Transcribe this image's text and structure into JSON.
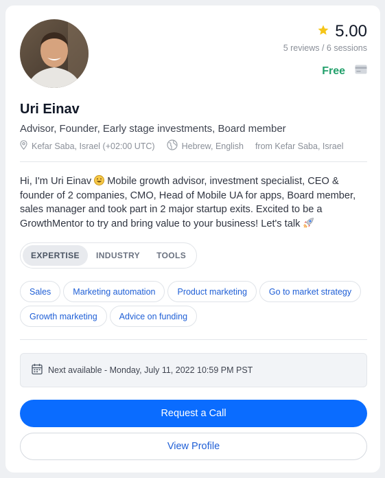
{
  "mentor": {
    "name": "Uri Einav",
    "title": "Advisor, Founder, Early stage investments, Board member",
    "location": "Kefar Saba, Israel (+02:00 UTC)",
    "languages": "Hebrew, English",
    "origin": "from Kefar Saba, Israel",
    "bio_parts": {
      "p1": "Hi, I'm Uri Einav ",
      "p2": " Mobile growth advisor, investment specialist, CEO & founder of 2 companies, CMO, Head of Mobile UA for apps, Board member, sales manager and took part in 2 major startup exits. Excited to be a GrowthMentor to try and bring value to your business! Let's talk "
    }
  },
  "rating": {
    "value": "5.00",
    "reviews_text": "5 reviews / 6 sessions",
    "star_color": "#f5c518"
  },
  "price": {
    "label": "Free",
    "color": "#22a06b"
  },
  "tabs": [
    "EXPERTISE",
    "INDUSTRY",
    "TOOLS"
  ],
  "active_tab": "EXPERTISE",
  "chips": [
    "Sales",
    "Marketing automation",
    "Product marketing",
    "Go to market strategy",
    "Growth marketing",
    "Advice on funding"
  ],
  "availability": "Next available - Monday, July 11, 2022 10:59 PM PST",
  "buttons": {
    "primary": "Request a Call",
    "secondary": "View Profile"
  },
  "icons": [
    "star-icon",
    "credit-card-icon",
    "location-pin-icon",
    "globe-icon",
    "grinning-face-emoji",
    "rocket-emoji",
    "calendar-icon"
  ],
  "colors": {
    "accent": "#0a6cff",
    "chip_text": "#1f5fd6"
  }
}
